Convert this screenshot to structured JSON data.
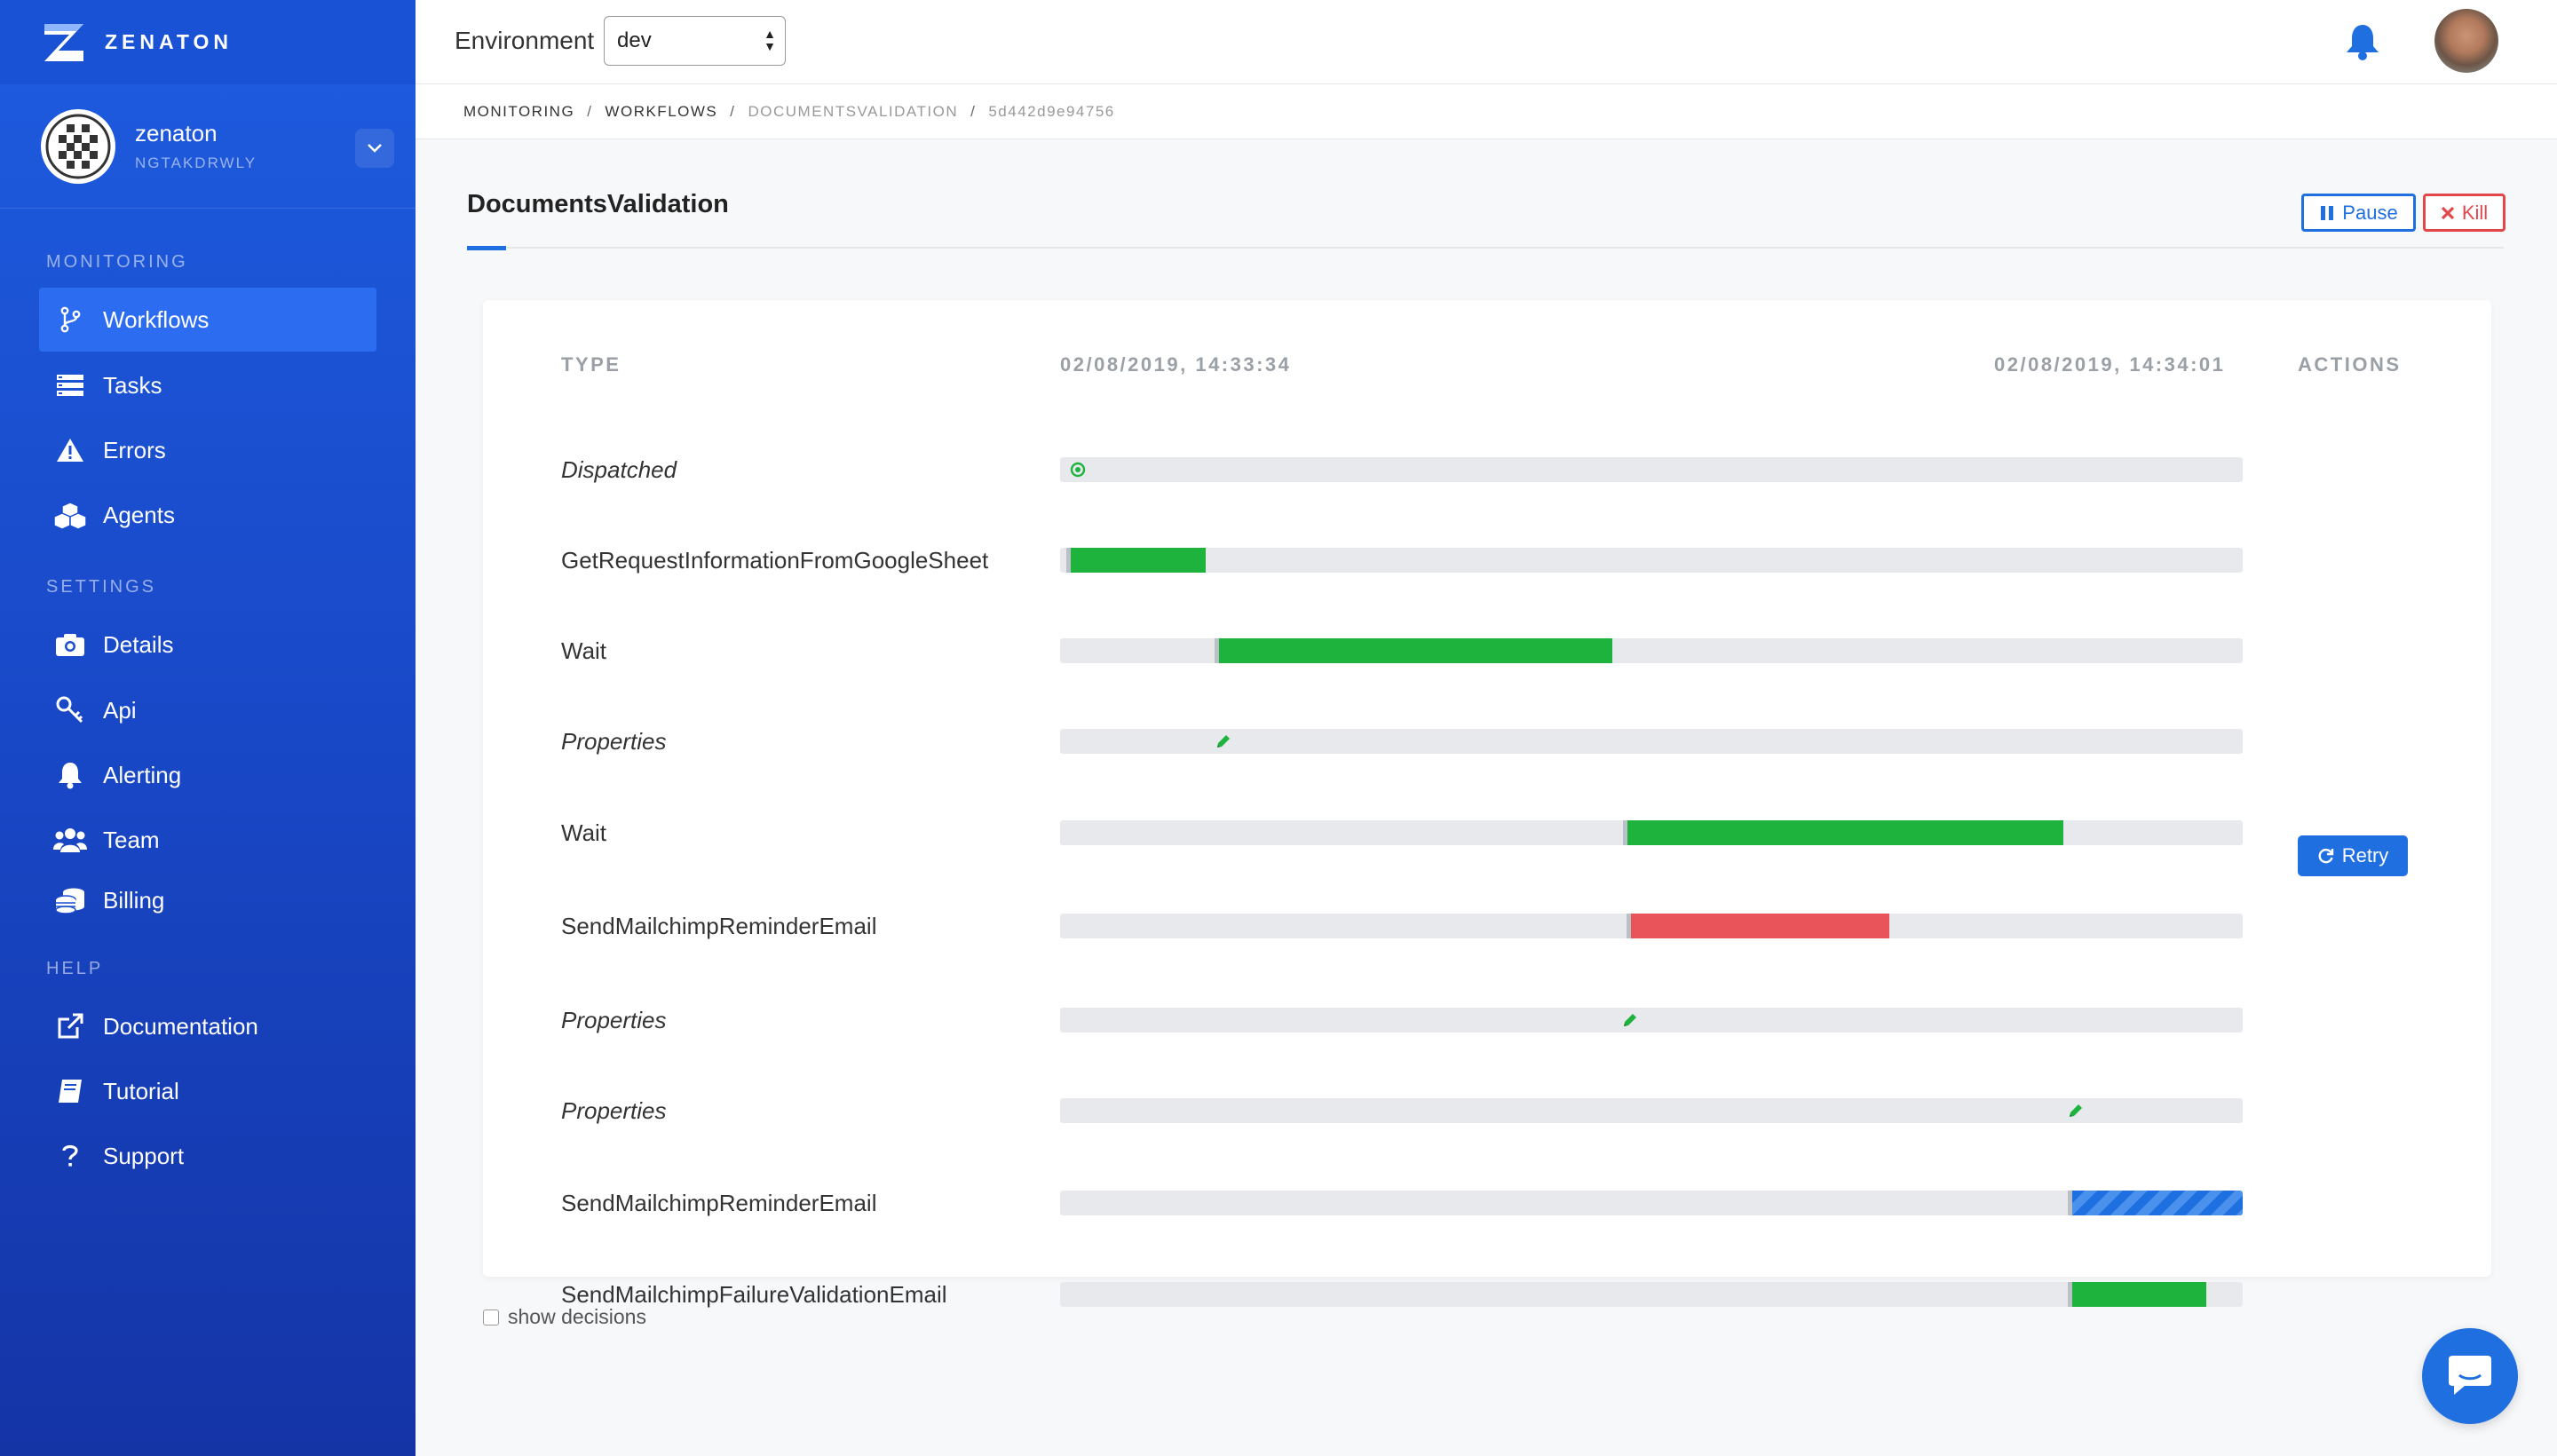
{
  "brand": {
    "name": "ZENATON",
    "logo_icon": "zenaton-z-logo"
  },
  "account": {
    "name": "zenaton",
    "id": "NGTAKDRWLY"
  },
  "sidebar": {
    "sections": [
      {
        "title": "MONITORING"
      },
      {
        "title": "SETTINGS"
      },
      {
        "title": "HELP"
      }
    ],
    "items": [
      {
        "label": "Workflows",
        "icon": "branch-icon",
        "active": true
      },
      {
        "label": "Tasks",
        "icon": "tasks-icon"
      },
      {
        "label": "Errors",
        "icon": "warning-icon"
      },
      {
        "label": "Agents",
        "icon": "cubes-icon"
      },
      {
        "label": "Details",
        "icon": "camera-icon"
      },
      {
        "label": "Api",
        "icon": "key-icon"
      },
      {
        "label": "Alerting",
        "icon": "bell-icon"
      },
      {
        "label": "Team",
        "icon": "users-icon"
      },
      {
        "label": "Billing",
        "icon": "coins-icon"
      },
      {
        "label": "Documentation",
        "icon": "external-link-icon"
      },
      {
        "label": "Tutorial",
        "icon": "book-icon"
      },
      {
        "label": "Support",
        "icon": "question-icon"
      }
    ]
  },
  "topbar": {
    "environment_label": "Environment",
    "environment_value": "dev",
    "notification_icon": "bell-icon",
    "avatar_icon": "user-avatar"
  },
  "breadcrumb": [
    "MONITORING",
    "WORKFLOWS",
    "DOCUMENTSVALIDATION",
    "5d442d9e94756"
  ],
  "page": {
    "title": "DocumentsValidation",
    "pause_label": "Pause",
    "kill_label": "Kill"
  },
  "timeline": {
    "headers": {
      "type": "TYPE",
      "start_time": "02/08/2019, 14:33:34",
      "end_time": "02/08/2019, 14:34:01",
      "actions": "ACTIONS"
    },
    "rows": [
      {
        "type": "Dispatched",
        "italic": true,
        "kind": "marker",
        "marker": "dispatch-icon",
        "at": 0.015
      },
      {
        "type": "GetRequestInformationFromGoogleSheet",
        "italic": false,
        "kind": "bar",
        "status": "completed",
        "start": 0.005,
        "end": 0.123
      },
      {
        "type": "Wait",
        "italic": false,
        "kind": "bar",
        "status": "completed",
        "start": 0.131,
        "end": 0.467
      },
      {
        "type": "Properties",
        "italic": true,
        "kind": "marker",
        "marker": "pencil-icon",
        "at": 0.138
      },
      {
        "type": "Wait",
        "italic": false,
        "kind": "bar",
        "status": "completed",
        "start": 0.476,
        "end": 0.848
      },
      {
        "type": "SendMailchimpReminderEmail",
        "italic": false,
        "kind": "bar",
        "status": "failed",
        "start": 0.479,
        "end": 0.701,
        "action": "Retry"
      },
      {
        "type": "Properties",
        "italic": true,
        "kind": "marker",
        "marker": "pencil-icon",
        "at": 0.482
      },
      {
        "type": "Properties",
        "italic": true,
        "kind": "marker",
        "marker": "pencil-icon",
        "at": 0.859
      },
      {
        "type": "SendMailchimpReminderEmail",
        "italic": false,
        "kind": "bar",
        "status": "running",
        "start": 0.852,
        "end": 1.0
      },
      {
        "type": "SendMailchimpFailureValidationEmail",
        "italic": false,
        "kind": "bar",
        "status": "completed",
        "start": 0.852,
        "end": 0.969
      }
    ]
  },
  "footer": {
    "show_decisions_label": "show decisions",
    "show_decisions_checked": false,
    "chat_icon": "chat-icon"
  },
  "colors": {
    "sidebar": "#1a4fd0",
    "accent": "#1f6fe0",
    "completed": "#1db33c",
    "failed": "#e8545a",
    "running": "#1e6fe0",
    "track": "#e7e9ec"
  }
}
